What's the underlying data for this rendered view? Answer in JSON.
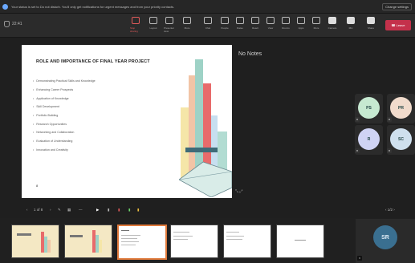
{
  "banner": {
    "message": "Your status is set to Do not disturb. You'll only get notifications for urgent messages and from your priority contacts.",
    "dismiss_label": "Change settings"
  },
  "toolbar": {
    "timer": "22:41",
    "buttons": [
      "Stop sharing",
      "Layout",
      "Presenter view",
      "More",
      "Chat",
      "People",
      "Raise",
      "React",
      "View",
      "Rooms",
      "Apps",
      "More",
      "Camera",
      "Mic",
      "Share"
    ],
    "leave_label": "Leave"
  },
  "slide": {
    "title": "ROLE AND IMPORTANCE OF FINAL YEAR PROJECT",
    "bullets": [
      "Demonstrating Practical Skills and Knowledge",
      "Enhancing Career Prospects",
      "Application of Knowledge",
      "Skill Development",
      "Portfolio Building",
      "Research Opportunities",
      "Networking and Collaboration",
      "Evaluation of Understanding",
      "Innovation and Creativity"
    ],
    "number": "8"
  },
  "notes": {
    "text": "No Notes"
  },
  "participants": [
    {
      "initials": "PS",
      "color": "#c6e9d1"
    },
    {
      "initials": "PR",
      "color": "#f1dbcc"
    },
    {
      "initials": "R",
      "color": "#cfd3f4"
    },
    {
      "initials": "SC",
      "color": "#cfe0ee"
    }
  ],
  "controls": {
    "prev": "‹",
    "page": "1 of 8",
    "next": "›",
    "participants_page": "1/2"
  },
  "thumbnails": [
    {
      "label": "Slide 1",
      "selected": false
    },
    {
      "label": "Slide 2",
      "selected": false
    },
    {
      "label": "Slide 3",
      "selected": true
    },
    {
      "label": "Slide 4",
      "selected": false
    },
    {
      "label": "Slide 5",
      "selected": false
    },
    {
      "label": "Slide 6",
      "selected": false
    }
  ],
  "self_view": {
    "initials": "SR"
  }
}
